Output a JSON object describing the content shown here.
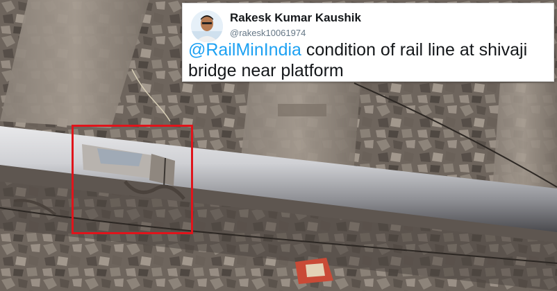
{
  "tweet": {
    "author_name": "Rakesk Kumar Kaushik",
    "author_handle": "@rakesk10061974",
    "mention": "@RailMinIndia",
    "body_text": " condition of rail line at shivaji bridge near platform"
  },
  "colors": {
    "mention_blue": "#1da1f2",
    "highlight_red": "#e0141b"
  }
}
